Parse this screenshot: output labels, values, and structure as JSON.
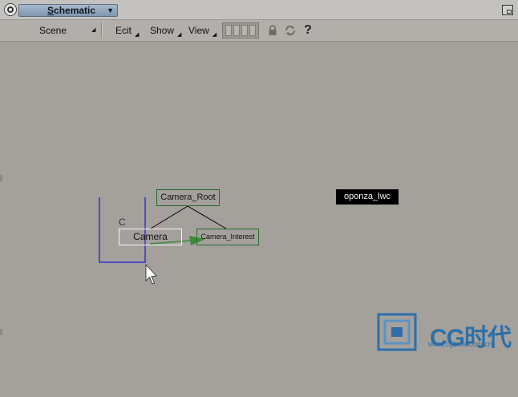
{
  "window": {
    "title": "Schematic",
    "title_dropdown_glyph": "▼"
  },
  "menubar": {
    "scene_label": "Scene",
    "edit_label": "Ecit",
    "show_label": "Show",
    "view_label": "View",
    "submenu_glyph": "◢"
  },
  "toolbar": {
    "lock_icon": "lock-icon",
    "refresh_icon": "refresh-icon",
    "help_icon": "help-icon",
    "help_glyph": "?"
  },
  "schematic": {
    "root_node": "Camera_Root",
    "camera_node": "Camera",
    "interest_node": "Camera_Interest",
    "scene_node": "oponza_lwc",
    "camera_label": "C"
  },
  "watermark": {
    "logo_text": "CG时代",
    "url": "www.cgtime.com.cn"
  },
  "colors": {
    "canvas": "#a4a09c",
    "node_border_green": "#2a6a2a",
    "selection_blue": "#1a1ad8",
    "constraint_green": "#3c8a3c",
    "watermark_blue": "#2d6fa8"
  }
}
